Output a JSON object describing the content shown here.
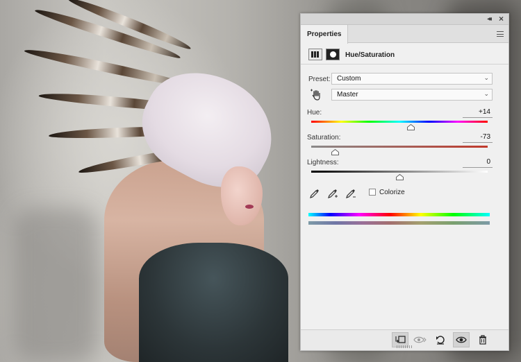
{
  "panel": {
    "tab_label": "Properties",
    "title": "Hue/Saturation",
    "preset_label": "Preset:",
    "preset_value": "Custom",
    "channel_value": "Master",
    "hue": {
      "label": "Hue:",
      "value": "+14",
      "position": 0.566
    },
    "saturation": {
      "label": "Saturation:",
      "value": "-73",
      "position": 0.135
    },
    "lightness": {
      "label": "Lightness:",
      "value": "0",
      "position": 0.5
    },
    "colorize_label": "Colorize",
    "colorize_checked": false
  },
  "icons": {
    "collapse": "double-chevron-right-icon",
    "close": "close-icon",
    "menu": "panel-menu-icon",
    "adjustment": "hue-saturation-adjustment-icon",
    "mask": "layer-mask-icon",
    "target": "targeted-adjustment-hand-icon",
    "eyedropper": "eyedropper-icon",
    "eyedropper_add": "eyedropper-add-icon",
    "eyedropper_subtract": "eyedropper-subtract-icon",
    "clip": "clip-to-layer-icon",
    "view_previous": "view-previous-state-icon",
    "reset": "reset-icon",
    "visibility": "visibility-eye-icon",
    "delete": "trash-icon"
  },
  "colors": {
    "panel_bg": "#f0f0f0",
    "saturation_track_end": "#c0392b"
  }
}
